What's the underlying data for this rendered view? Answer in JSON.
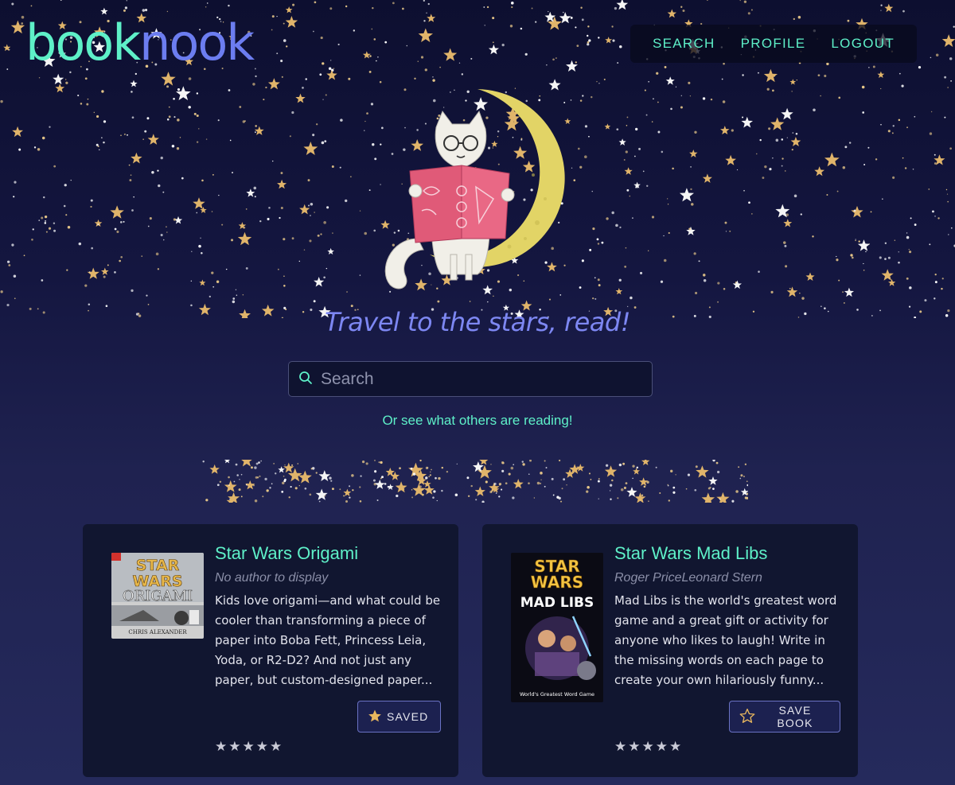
{
  "brand": {
    "logo_part1": "book",
    "logo_part2": "nook"
  },
  "nav": {
    "search": "SEARCH",
    "profile": "PROFILE",
    "logout": "LOGOUT"
  },
  "hero": {
    "tagline": "Travel to the stars, read!"
  },
  "search": {
    "placeholder": "Search",
    "value": ""
  },
  "see_others": "Or see what others are reading!",
  "books": [
    {
      "title": "Star Wars Origami",
      "author": "No author to display",
      "description": "Kids love origami—and what could be cooler than transforming a piece of paper into Boba Fett, Princess Leia, Yoda, or R2-D2? And not just any paper, but custom-designed paper...",
      "button_label": "SAVED",
      "saved": true,
      "rating_stars": 5,
      "cover": {
        "line1": "STAR",
        "line2": "WARS",
        "line3": "ORIGAMI",
        "author": "CHRIS ALEXANDER"
      }
    },
    {
      "title": "Star Wars Mad Libs",
      "author": "Roger PriceLeonard Stern",
      "description": "Mad Libs is the world's greatest word game and a great gift or activity for anyone who likes to laugh! Write in the missing words on each page to create your own hilariously funny...",
      "button_label": "SAVE BOOK",
      "saved": false,
      "rating_stars": 5,
      "cover": {
        "line1": "STAR",
        "line2": "WARS",
        "line3": "MAD LIBS",
        "tagline": "World's Greatest Word Game"
      }
    }
  ],
  "colors": {
    "accent": "#5ef0c8",
    "brand_secondary": "#6c7df0",
    "star_gold": "#e0b46a",
    "card_bg": "#111630"
  },
  "icons": {
    "search": "search-icon",
    "saved_star": "star-filled-icon",
    "save_star": "star-outline-icon",
    "rating": "star-icon"
  }
}
